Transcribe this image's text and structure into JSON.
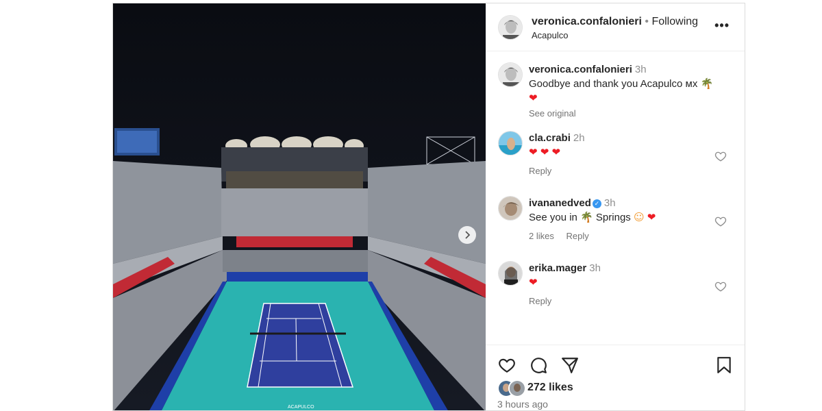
{
  "post": {
    "username": "veronica.confalonieri",
    "separator": "•",
    "follow_state": "Following",
    "location": "Acapulco",
    "more_label": "•••"
  },
  "caption": {
    "username": "veronica.confalonieri",
    "time": "3h",
    "text": "Goodbye and thank you Acapulco ᴍx",
    "see_original": "See original"
  },
  "comments": [
    {
      "username": "cla.crabi",
      "time": "2h",
      "text": "",
      "likes": "",
      "reply": "Reply"
    },
    {
      "username": "ivananedved",
      "time": "3h",
      "text": "See you in",
      "text2": "Springs",
      "likes": "2 likes",
      "reply": "Reply"
    },
    {
      "username": "erika.mager",
      "time": "3h",
      "text": "",
      "likes": "",
      "reply": "Reply"
    }
  ],
  "footer": {
    "likes": "272 likes",
    "time_ago": "3 hours ago"
  },
  "photo": {
    "court_banner": "ACAPULCO"
  },
  "colors": {
    "court": "#2f3f9e",
    "surround": "#2ab3b0",
    "sky": "#0b0d14",
    "heart": "#ed1c24"
  }
}
